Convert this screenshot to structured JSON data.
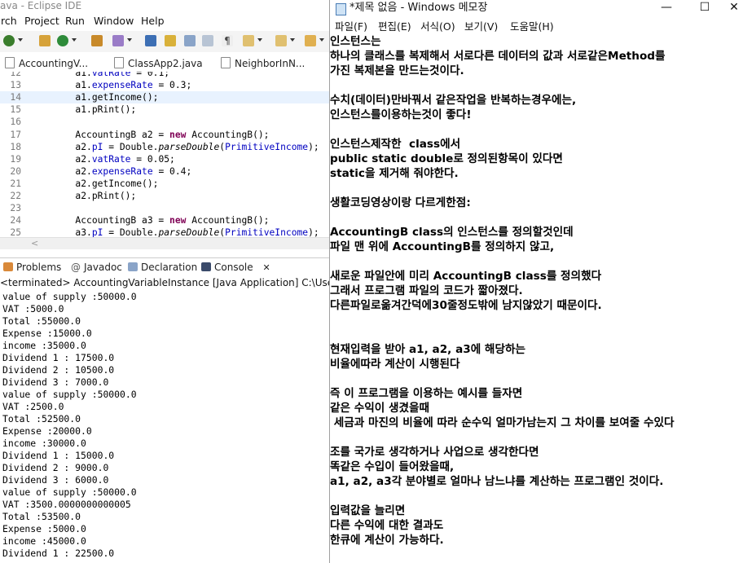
{
  "eclipse": {
    "title": "ava - Eclipse IDE",
    "menu": [
      "rch",
      "Project",
      "Run",
      "Window",
      "Help"
    ],
    "tabs": [
      {
        "label": "AccountingV...",
        "close": ""
      },
      {
        "label": "ClassApp2.java",
        "close": ""
      },
      {
        "label": "NeighborInN...",
        "close": ""
      }
    ],
    "editor_lines": [
      {
        "num": "12",
        "code": "        a1.vatRate = 0.1;"
      },
      {
        "num": "13",
        "code": "        a1.expenseRate = 0.3;"
      },
      {
        "num": "14",
        "code": "        a1.getIncome();"
      },
      {
        "num": "15",
        "code": "        a1.pRint();"
      },
      {
        "num": "16",
        "code": ""
      },
      {
        "num": "17",
        "code": "        AccountingB a2 = new AccountingB();"
      },
      {
        "num": "18",
        "code": "        a2.pI = Double.parseDouble(PrimitiveIncome);"
      },
      {
        "num": "19",
        "code": "        a2.vatRate = 0.05;"
      },
      {
        "num": "20",
        "code": "        a2.expenseRate = 0.4;"
      },
      {
        "num": "21",
        "code": "        a2.getIncome();"
      },
      {
        "num": "22",
        "code": "        a2.pRint();"
      },
      {
        "num": "23",
        "code": ""
      },
      {
        "num": "24",
        "code": "        AccountingB a3 = new AccountingB();"
      },
      {
        "num": "25",
        "code": "        a3.pI = Double.parseDouble(PrimitiveIncome);"
      }
    ],
    "views": {
      "problems": "Problems",
      "javadoc": "Javadoc",
      "declaration": "Declaration",
      "console": "Console",
      "console_close": "✕"
    },
    "console_status": "<terminated> AccountingVariableInstance [Java Application] C:\\Users\\MY",
    "console_lines": [
      "value of supply :50000.0",
      "VAT :5000.0",
      "Total :55000.0",
      "Expense :15000.0",
      "income :35000.0",
      "Dividend 1 : 17500.0",
      "Dividend 2 : 10500.0",
      "Dividend 3 : 7000.0",
      "value of supply :50000.0",
      "VAT :2500.0",
      "Total :52500.0",
      "Expense :20000.0",
      "income :30000.0",
      "Dividend 1 : 15000.0",
      "Dividend 2 : 9000.0",
      "Dividend 3 : 6000.0",
      "value of supply :50000.0",
      "VAT :3500.0000000000005",
      "Total :53500.0",
      "Expense :5000.0",
      "income :45000.0",
      "Dividend 1 : 22500.0"
    ]
  },
  "notepad": {
    "title": "*제목 없음 - Windows 메모장",
    "minimize": "—",
    "maximize": "☐",
    "close": "✕",
    "menu": [
      "파일(F)",
      "편집(E)",
      "서식(O)",
      "보기(V)",
      "도움말(H)"
    ],
    "lines": [
      "인스턴스는",
      "하나의 클래스를 복제해서 서로다른 데이터의 값과 서로같은Method를",
      "가진 복제본을 만드는것이다.",
      "",
      "수치(데이터)만바꿔서 같은작업을 반복하는경우에는,",
      "인스턴스를이용하는것이 좋다!",
      "",
      "인스턴스제작한  class에서",
      "public static double로 정의된항목이 있다면",
      "static을 제거해 줘야한다.",
      "",
      "생활코딩영상이랑 다르게한점:",
      "",
      "AccountingB class의 인스턴스를 정의할것인데",
      "파일 맨 위에 AccountingB를 정의하지 않고,",
      "",
      "새로운 파일안에 미리 AccountingB class를 정의했다",
      "그래서 프로그램 파일의 코드가 짧아졌다.",
      "다른파일로옮겨간덕에30줄정도밖에 남지않았기 때문이다.",
      "",
      "",
      "현재입력을 받아 a1, a2, a3에 해당하는",
      "비율에따라 계산이 시행된다",
      "",
      "즉 이 프로그램을 이용하는 예시를 들자면",
      "같은 수익이 생겼을때",
      " 세금과 마진의 비율에 따라 순수익 얼마가남는지 그 차이를 보여줄 수있다",
      "",
      "조를 국가로 생각하거나 사업으로 생각한다면",
      "똑같은 수입이 들어왔을때,",
      "a1, a2, a3각 분야별로 얼마나 남느냐를 계산하는 프로그램인 것이다.",
      "",
      "입력값을 늘리면",
      "다른 수익에 대한 결과도",
      "한큐에 계산이 가능하다."
    ]
  }
}
